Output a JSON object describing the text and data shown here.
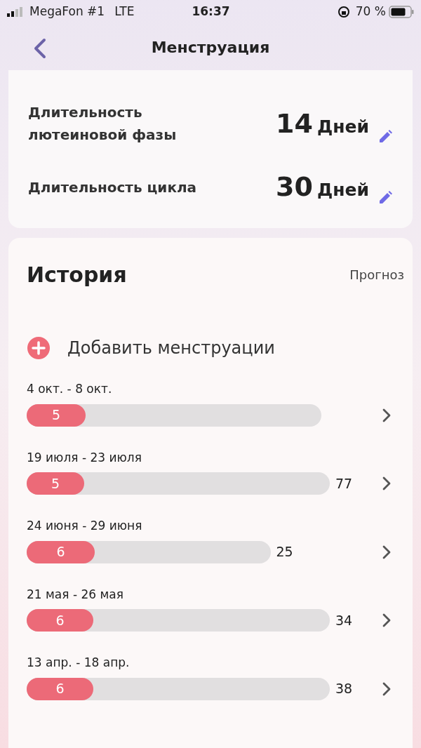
{
  "status_bar": {
    "carrier": "MegaFon #1",
    "network": "LTE",
    "time": "16:37",
    "battery": "70 %"
  },
  "nav": {
    "title": "Менструация"
  },
  "settings": [
    {
      "label": "Длительность лютеиновой фазы",
      "value": "14",
      "unit": "Дней"
    },
    {
      "label": "Длительность цикла",
      "value": "30",
      "unit": "Дней"
    }
  ],
  "history": {
    "title": "История",
    "forecast_link": "Прогноз",
    "add_button": "Добавить менструации",
    "periods": [
      {
        "dates": "4 окт. - 8 окт.",
        "days": "5",
        "level": 0.2
      },
      {
        "dates": "19 июля - 23 июля",
        "days": "5",
        "level": 0.19,
        "cycle": "77"
      },
      {
        "dates": "24 июня - 29 июня",
        "days": "6",
        "level": 0.28,
        "cycle": "25"
      },
      {
        "dates": "21 мая - 26 мая",
        "days": "6",
        "level": 0.22,
        "cycle": "34"
      },
      {
        "dates": "13 апр. - 18 апр.",
        "days": "6",
        "level": 0.22,
        "cycle": "38"
      }
    ]
  }
}
